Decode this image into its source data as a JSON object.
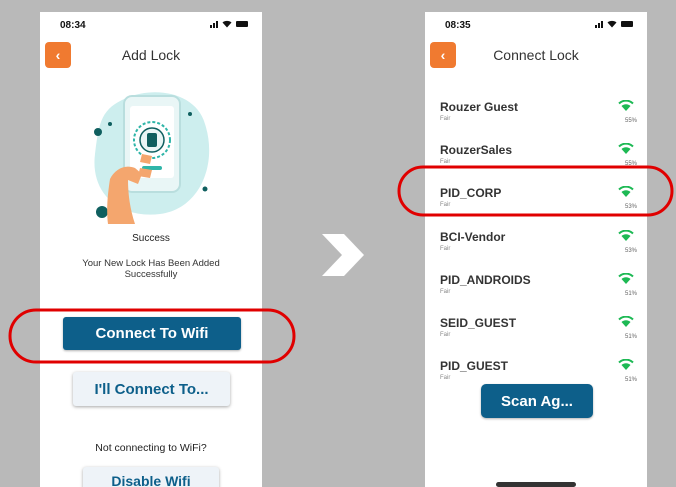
{
  "left_screen": {
    "status_time": "08:34",
    "title": "Add Lock",
    "success_label": "Success",
    "success_message": "Your New Lock Has Been Added Successfully",
    "connect_wifi_label": "Connect To Wifi",
    "connect_later_label": "I'll Connect To...",
    "not_connecting_label": "Not connecting to WiFi?",
    "disable_wifi_label": "Disable Wifi"
  },
  "right_screen": {
    "status_time": "08:35",
    "title": "Connect Lock",
    "networks": [
      {
        "name": "Rouzer Guest",
        "quality": "Fair",
        "signal": "55%"
      },
      {
        "name": "RouzerSales",
        "quality": "Fair",
        "signal": "55%"
      },
      {
        "name": "PID_CORP",
        "quality": "Fair",
        "signal": "53%"
      },
      {
        "name": "BCI-Vendor",
        "quality": "Fair",
        "signal": "53%"
      },
      {
        "name": "PID_ANDROIDS",
        "quality": "Fair",
        "signal": "51%"
      },
      {
        "name": "SEID_GUEST",
        "quality": "Fair",
        "signal": "51%"
      },
      {
        "name": "PID_GUEST",
        "quality": "Fair",
        "signal": "51%"
      }
    ],
    "scan_again_label": "Scan Ag..."
  },
  "colors": {
    "accent_orange": "#f07a30",
    "primary_blue": "#0d5f8a",
    "wifi_green": "#1db954",
    "highlight_red": "#e00000"
  },
  "icons": {
    "back": "chevron-left-icon",
    "wifi": "wifi-icon",
    "arrow": "chevron-right-icon"
  }
}
